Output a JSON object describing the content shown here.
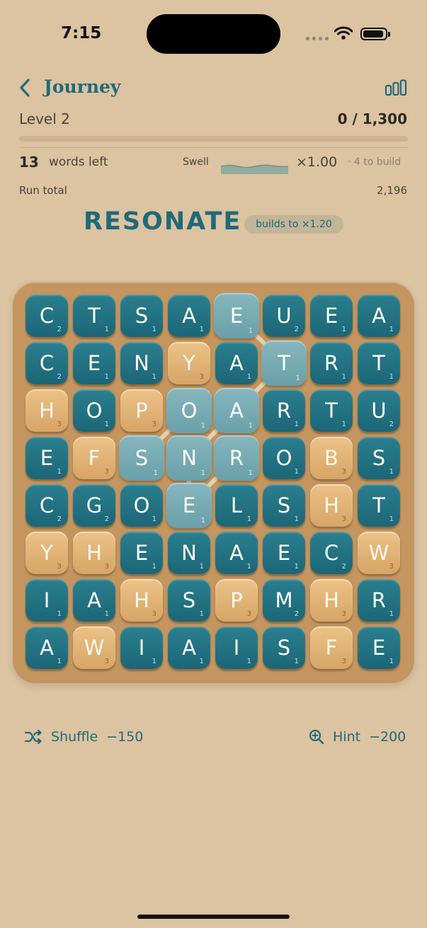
{
  "status": {
    "time": "7:15"
  },
  "header": {
    "title": "Journey"
  },
  "level": {
    "label": "Level 2",
    "score": "0 / 1,300",
    "progress": 0
  },
  "info": {
    "words_left_count": "13",
    "words_left_label": "words left",
    "swell_label": "Swell",
    "multiplier": "×1.00",
    "build_note": "· 4 to build",
    "run_total_label": "Run total",
    "run_total_value": "2,196"
  },
  "current": {
    "word": "RESONATE",
    "bonus": "builds to ×1.20"
  },
  "board": {
    "rows": [
      [
        [
          "C",
          "2",
          "t"
        ],
        [
          "T",
          "1",
          "t"
        ],
        [
          "S",
          "1",
          "t"
        ],
        [
          "A",
          "1",
          "t"
        ],
        [
          "E",
          "1",
          "s"
        ],
        [
          "U",
          "2",
          "t"
        ],
        [
          "E",
          "1",
          "t"
        ],
        [
          "A",
          "1",
          "t"
        ]
      ],
      [
        [
          "C",
          "2",
          "t"
        ],
        [
          "E",
          "1",
          "t"
        ],
        [
          "N",
          "1",
          "t"
        ],
        [
          "Y",
          "3",
          "g"
        ],
        [
          "A",
          "1",
          "t"
        ],
        [
          "T",
          "1",
          "s"
        ],
        [
          "R",
          "1",
          "t"
        ],
        [
          "T",
          "1",
          "t"
        ]
      ],
      [
        [
          "H",
          "3",
          "g"
        ],
        [
          "O",
          "1",
          "t"
        ],
        [
          "P",
          "3",
          "g"
        ],
        [
          "O",
          "1",
          "s"
        ],
        [
          "A",
          "1",
          "s"
        ],
        [
          "R",
          "1",
          "t"
        ],
        [
          "T",
          "1",
          "t"
        ],
        [
          "U",
          "2",
          "t"
        ]
      ],
      [
        [
          "E",
          "1",
          "t"
        ],
        [
          "F",
          "3",
          "g"
        ],
        [
          "S",
          "1",
          "s"
        ],
        [
          "N",
          "1",
          "s"
        ],
        [
          "R",
          "1",
          "s"
        ],
        [
          "O",
          "1",
          "t"
        ],
        [
          "B",
          "3",
          "g"
        ],
        [
          "S",
          "1",
          "t"
        ]
      ],
      [
        [
          "C",
          "2",
          "t"
        ],
        [
          "G",
          "2",
          "t"
        ],
        [
          "O",
          "1",
          "t"
        ],
        [
          "E",
          "1",
          "s"
        ],
        [
          "L",
          "1",
          "t"
        ],
        [
          "S",
          "1",
          "t"
        ],
        [
          "H",
          "3",
          "g"
        ],
        [
          "T",
          "1",
          "t"
        ]
      ],
      [
        [
          "Y",
          "3",
          "g"
        ],
        [
          "H",
          "3",
          "g"
        ],
        [
          "E",
          "1",
          "t"
        ],
        [
          "N",
          "1",
          "t"
        ],
        [
          "A",
          "1",
          "t"
        ],
        [
          "E",
          "1",
          "t"
        ],
        [
          "C",
          "2",
          "t"
        ],
        [
          "W",
          "3",
          "g"
        ]
      ],
      [
        [
          "I",
          "1",
          "t"
        ],
        [
          "A",
          "1",
          "t"
        ],
        [
          "H",
          "3",
          "g"
        ],
        [
          "S",
          "1",
          "t"
        ],
        [
          "P",
          "3",
          "g"
        ],
        [
          "M",
          "2",
          "t"
        ],
        [
          "H",
          "3",
          "g"
        ],
        [
          "R",
          "1",
          "t"
        ]
      ],
      [
        [
          "A",
          "1",
          "t"
        ],
        [
          "W",
          "3",
          "g"
        ],
        [
          "I",
          "1",
          "t"
        ],
        [
          "A",
          "1",
          "t"
        ],
        [
          "I",
          "1",
          "t"
        ],
        [
          "S",
          "1",
          "t"
        ],
        [
          "F",
          "3",
          "g"
        ],
        [
          "E",
          "1",
          "t"
        ]
      ]
    ],
    "path": [
      [
        3,
        1
      ],
      [
        4,
        1
      ],
      [
        4,
        1
      ],
      [
        5,
        1
      ]
    ]
  },
  "actions": {
    "shuffle_label": "Shuffle",
    "shuffle_cost": "−150",
    "hint_label": "Hint",
    "hint_cost": "−200"
  },
  "colors": {
    "accent": "#1f6a7a",
    "background": "#dcc3a1",
    "tile_teal": "#1f6f80",
    "tile_gold": "#e3b577",
    "tile_selected": "#78aab3",
    "board": "#c4955e"
  }
}
